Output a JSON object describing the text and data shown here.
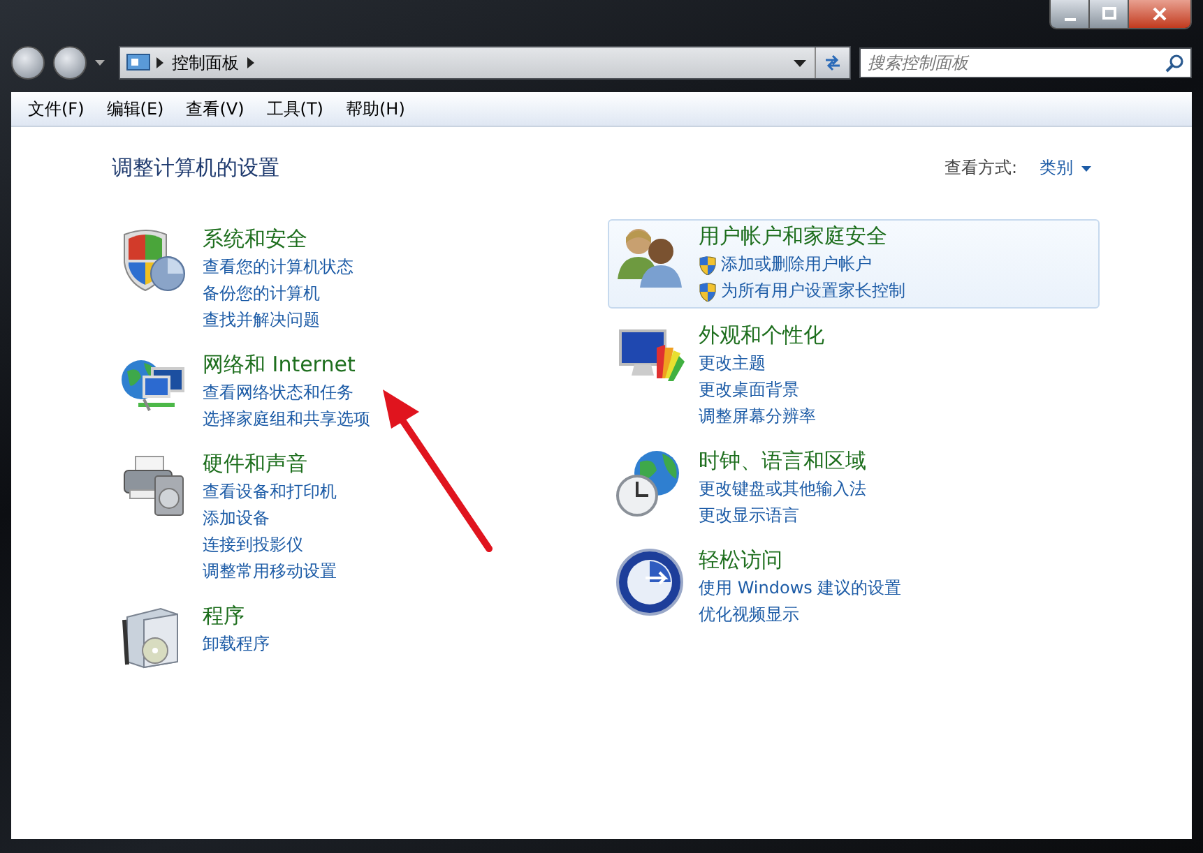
{
  "address_bar": {
    "crumbs": [
      {
        "label": "控制面板"
      }
    ]
  },
  "search": {
    "placeholder": "搜索控制面板"
  },
  "menu": [
    {
      "label": "文件(F)"
    },
    {
      "label": "编辑(E)"
    },
    {
      "label": "查看(V)"
    },
    {
      "label": "工具(T)"
    },
    {
      "label": "帮助(H)"
    }
  ],
  "heading": "调整计算机的设置",
  "view_by": {
    "label": "查看方式:",
    "value": "类别"
  },
  "columns": [
    [
      {
        "title": "系统和安全",
        "highlighted": false,
        "links": [
          {
            "text": "查看您的计算机状态",
            "shield": false
          },
          {
            "text": "备份您的计算机",
            "shield": false
          },
          {
            "text": "查找并解决问题",
            "shield": false
          }
        ]
      },
      {
        "title": "网络和 Internet",
        "highlighted": false,
        "links": [
          {
            "text": "查看网络状态和任务",
            "shield": false
          },
          {
            "text": "选择家庭组和共享选项",
            "shield": false
          }
        ]
      },
      {
        "title": "硬件和声音",
        "highlighted": false,
        "links": [
          {
            "text": "查看设备和打印机",
            "shield": false
          },
          {
            "text": "添加设备",
            "shield": false
          },
          {
            "text": "连接到投影仪",
            "shield": false
          },
          {
            "text": "调整常用移动设置",
            "shield": false
          }
        ]
      },
      {
        "title": "程序",
        "highlighted": false,
        "links": [
          {
            "text": "卸载程序",
            "shield": false
          }
        ]
      }
    ],
    [
      {
        "title": "用户帐户和家庭安全",
        "highlighted": true,
        "links": [
          {
            "text": "添加或删除用户帐户",
            "shield": true
          },
          {
            "text": "为所有用户设置家长控制",
            "shield": true
          }
        ]
      },
      {
        "title": "外观和个性化",
        "highlighted": false,
        "links": [
          {
            "text": "更改主题",
            "shield": false
          },
          {
            "text": "更改桌面背景",
            "shield": false
          },
          {
            "text": "调整屏幕分辨率",
            "shield": false
          }
        ]
      },
      {
        "title": "时钟、语言和区域",
        "highlighted": false,
        "links": [
          {
            "text": "更改键盘或其他输入法",
            "shield": false
          },
          {
            "text": "更改显示语言",
            "shield": false
          }
        ]
      },
      {
        "title": "轻松访问",
        "highlighted": false,
        "links": [
          {
            "text": "使用 Windows 建议的设置",
            "shield": false
          },
          {
            "text": "优化视频显示",
            "shield": false
          }
        ]
      }
    ]
  ]
}
